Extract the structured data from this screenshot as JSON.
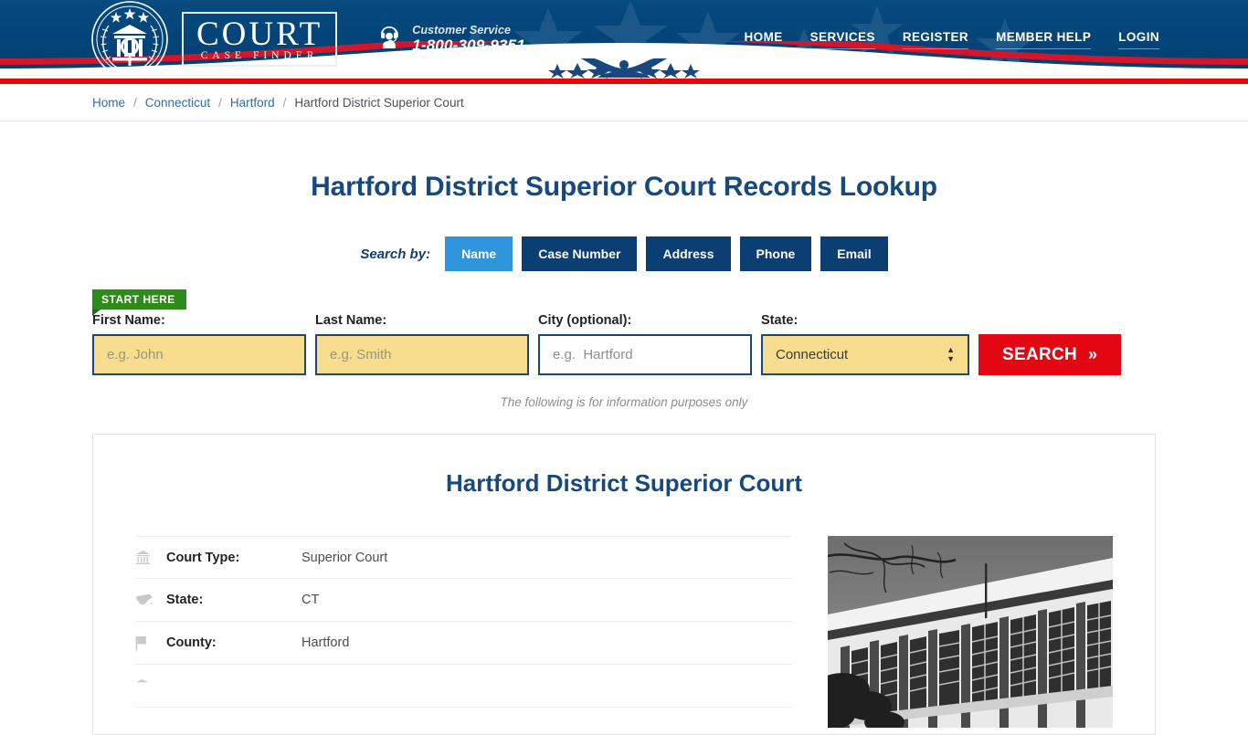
{
  "header": {
    "logo": {
      "word_main": "COURT",
      "word_sub": "CASE FINDER"
    },
    "customer_service": {
      "label": "Customer Service",
      "phone": "1-800-309-9351"
    },
    "nav": [
      {
        "label": "HOME"
      },
      {
        "label": "SERVICES"
      },
      {
        "label": "REGISTER"
      },
      {
        "label": "MEMBER HELP"
      },
      {
        "label": "LOGIN"
      }
    ]
  },
  "breadcrumb": {
    "items": [
      {
        "label": "Home",
        "link": true
      },
      {
        "label": "Connecticut",
        "link": true
      },
      {
        "label": "Hartford",
        "link": true
      },
      {
        "label": "Hartford District Superior Court",
        "link": false
      }
    ],
    "separator": "/"
  },
  "main": {
    "page_title": "Hartford District Superior Court Records Lookup",
    "search_by_label": "Search by:",
    "tabs": [
      {
        "label": "Name",
        "active": true
      },
      {
        "label": "Case Number",
        "active": false
      },
      {
        "label": "Address",
        "active": false
      },
      {
        "label": "Phone",
        "active": false
      },
      {
        "label": "Email",
        "active": false
      }
    ],
    "start_here_badge": "START HERE",
    "form": {
      "first_name": {
        "label": "First Name:",
        "placeholder": "e.g. John",
        "value": ""
      },
      "last_name": {
        "label": "Last Name:",
        "placeholder": "e.g. Smith",
        "value": ""
      },
      "city": {
        "label": "City (optional):",
        "placeholder": "e.g.  Hartford",
        "value": ""
      },
      "state": {
        "label": "State:",
        "selected": "Connecticut"
      },
      "search_button": "SEARCH",
      "search_button_chevron": "»"
    },
    "info_note": "The following is for information purposes only"
  },
  "card": {
    "court_name": "Hartford District Superior Court",
    "facts": [
      {
        "icon": "courthouse-icon",
        "key": "Court Type:",
        "value": "Superior Court"
      },
      {
        "icon": "us-map-icon",
        "key": "State:",
        "value": "CT"
      },
      {
        "icon": "flag-icon",
        "key": "County:",
        "value": "Hartford"
      }
    ],
    "photo_alt": "courthouse-photo"
  },
  "colors": {
    "header_blue": "#05457a",
    "accent_blue": "#17497e",
    "tab_active": "#2e95dd",
    "red": "#e30613",
    "green_badge": "#2e8b19",
    "input_yellow": "#f9dd8f"
  }
}
